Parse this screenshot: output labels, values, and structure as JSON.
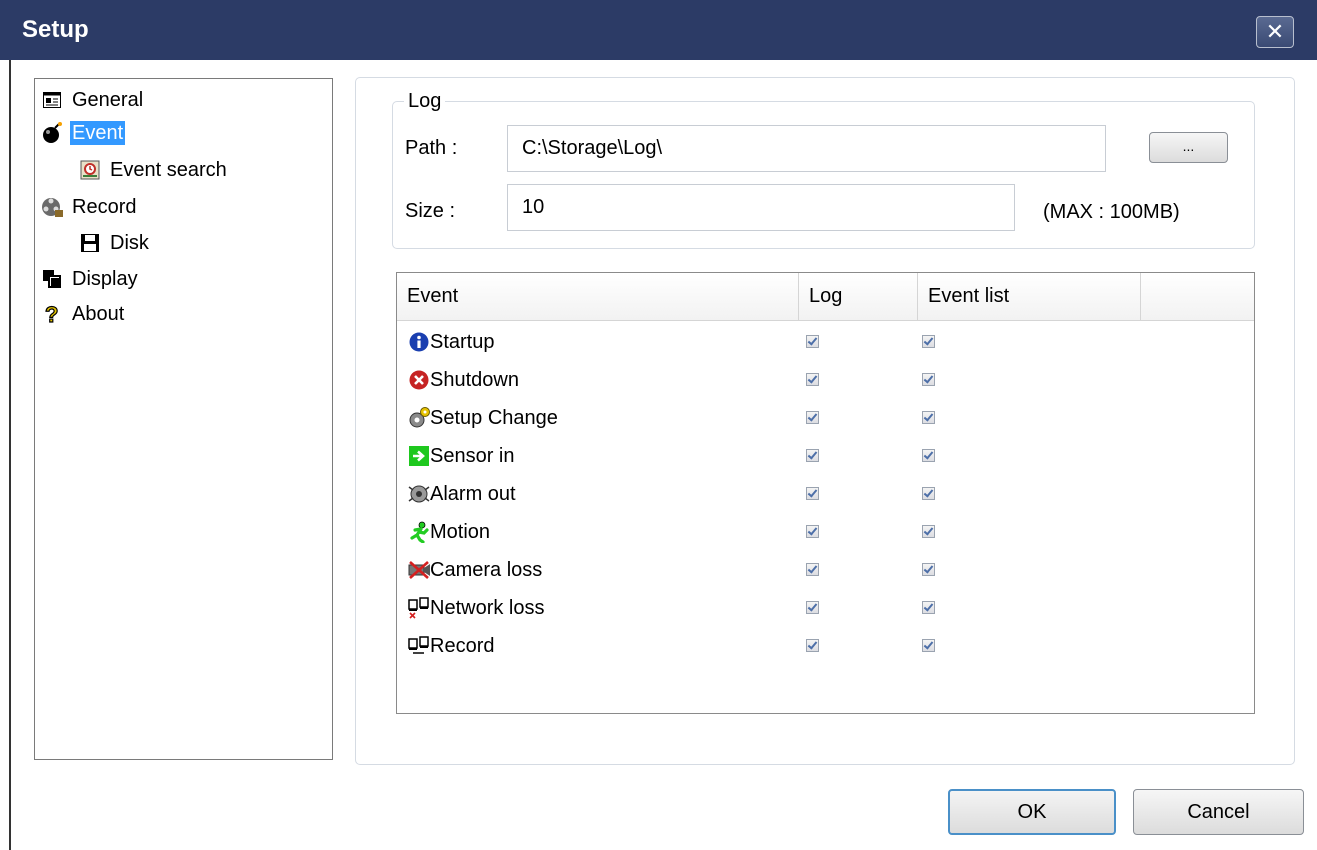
{
  "window": {
    "title": "Setup",
    "close_glyph": "✕"
  },
  "tree": {
    "items": [
      {
        "label": "General",
        "icon": "general-icon",
        "selected": false
      },
      {
        "label": "Event",
        "icon": "bomb-icon",
        "selected": true
      },
      {
        "label": "Event search",
        "icon": "event-search-icon",
        "selected": false
      },
      {
        "label": "Record",
        "icon": "film-reel-icon",
        "selected": false
      },
      {
        "label": "Disk",
        "icon": "floppy-disk-icon",
        "selected": false
      },
      {
        "label": "Display",
        "icon": "display-icon",
        "selected": false
      },
      {
        "label": "About",
        "icon": "question-icon",
        "selected": false
      }
    ]
  },
  "log": {
    "legend": "Log",
    "path_label": "Path :",
    "path_value": "C:\\Storage\\Log\\",
    "browse_label": "...",
    "size_label": "Size :",
    "size_value": "10",
    "max_note": "(MAX : 100MB)"
  },
  "table": {
    "headers": [
      "Event",
      "Log",
      "Event list"
    ],
    "rows": [
      {
        "name": "Startup",
        "icon": "info-icon",
        "log": true,
        "event_list": true
      },
      {
        "name": "Shutdown",
        "icon": "shutdown-icon",
        "log": true,
        "event_list": true
      },
      {
        "name": "Setup Change",
        "icon": "gears-icon",
        "log": true,
        "event_list": true
      },
      {
        "name": "Sensor in",
        "icon": "sensor-arrow-icon",
        "log": true,
        "event_list": true
      },
      {
        "name": "Alarm out",
        "icon": "alarm-icon",
        "log": true,
        "event_list": true
      },
      {
        "name": "Motion",
        "icon": "running-man-icon",
        "log": true,
        "event_list": true
      },
      {
        "name": "Camera loss",
        "icon": "camera-loss-icon",
        "log": true,
        "event_list": true
      },
      {
        "name": "Network loss",
        "icon": "network-loss-icon",
        "log": true,
        "event_list": true
      },
      {
        "name": "Record",
        "icon": "record-icon",
        "log": true,
        "event_list": true
      }
    ]
  },
  "buttons": {
    "ok": "OK",
    "cancel": "Cancel"
  },
  "colors": {
    "titlebar": "#2c3b66",
    "selection": "#3399ff",
    "checkmark": "#4d6fa8"
  }
}
